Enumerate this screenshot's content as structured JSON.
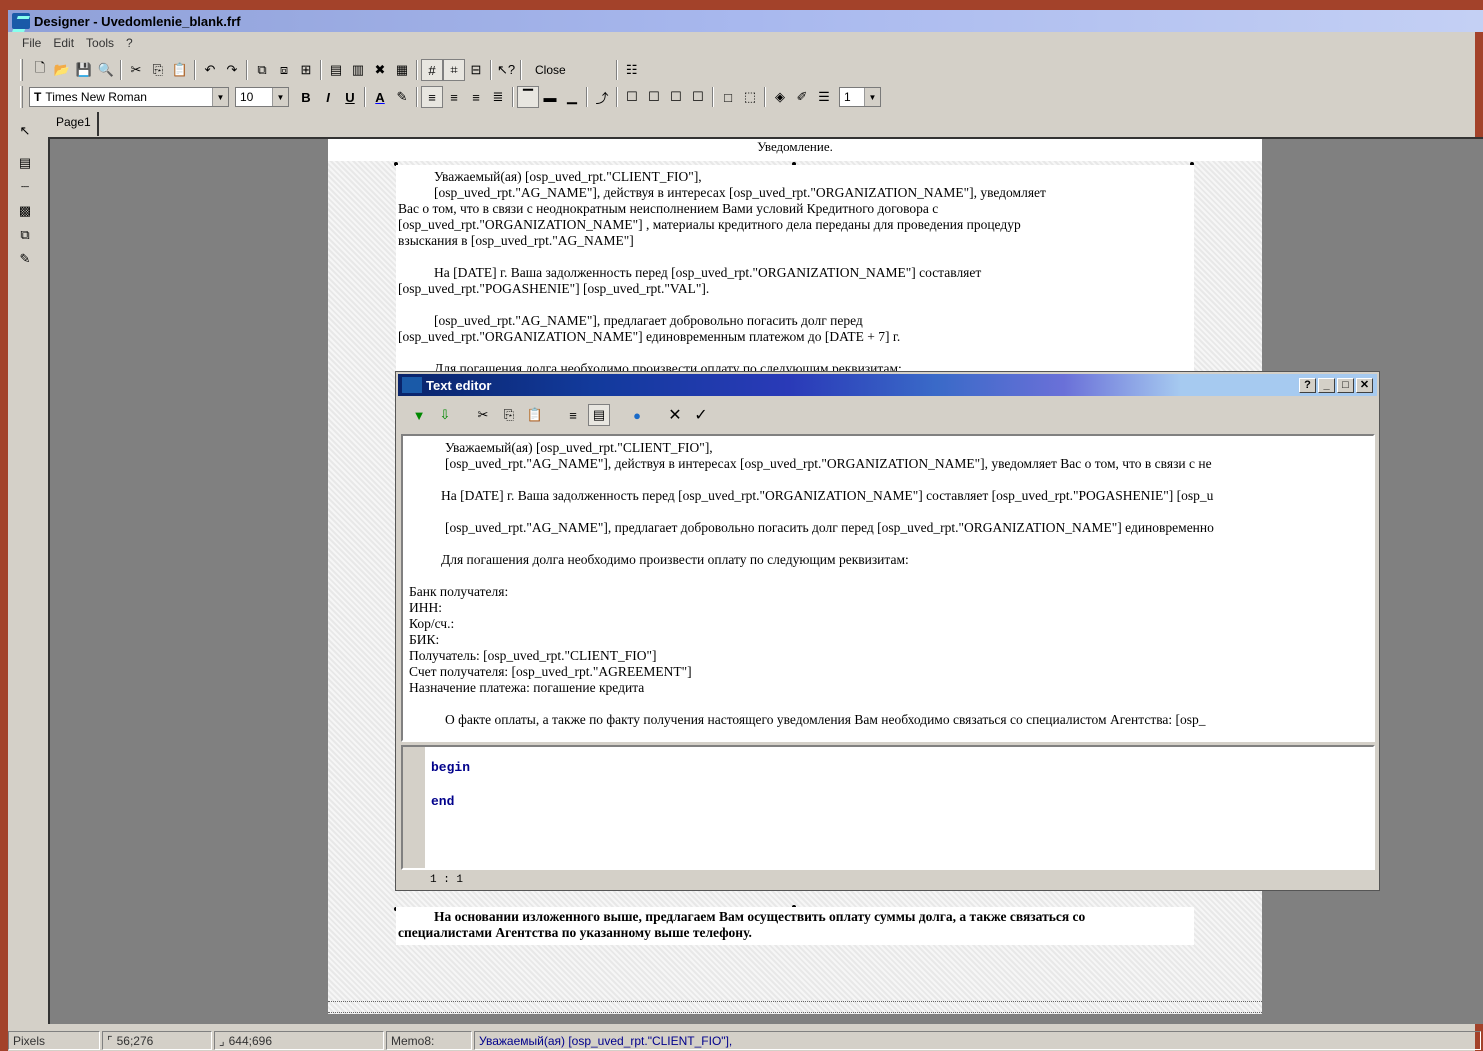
{
  "window": {
    "title": "Designer - Uvedomlenie_blank.frf"
  },
  "menu": [
    "File",
    "Edit",
    "Tools",
    "?"
  ],
  "toolbar": {
    "close_label": "Close"
  },
  "format": {
    "font_name": "Times New Roman",
    "font_size": "10",
    "frame_width": "1"
  },
  "tabs": [
    {
      "label": "Page1"
    }
  ],
  "page": {
    "header": "Уведомление.",
    "memo_lines": [
      "Уважаемый(ая) [osp_uved_rpt.\"CLIENT_FIO\"],",
      "[osp_uved_rpt.\"AG_NAME\"], действуя в интересах [osp_uved_rpt.\"ORGANIZATION_NAME\"], уведомляет",
      "Вас о том, что в связи с неоднократным неисполнением Вами условий Кредитного договора с",
      "[osp_uved_rpt.\"ORGANIZATION_NAME\"] , материалы кредитного дела переданы для проведения процедур",
      "взыскания в [osp_uved_rpt.\"AG_NAME\"]",
      "На [DATE] г. Ваша задолженность перед [osp_uved_rpt.\"ORGANIZATION_NAME\"] составляет",
      "[osp_uved_rpt.\"POGASHENIE\"] [osp_uved_rpt.\"VAL\"].",
      "[osp_uved_rpt.\"AG_NAME\"], предлагает добровольно погасить долг перед",
      "[osp_uved_rpt.\"ORGANIZATION_NAME\"] единовременным платежом до [DATE + 7] г.",
      "Для погашения долга необходимо произвести оплату по следующим реквизитам:"
    ],
    "bottom_memo_lines": [
      "На основании изложенного выше, предлагаем Вам осуществить оплату суммы долга, а также связаться со",
      "специалистами Агентства по указанному выше телефону."
    ]
  },
  "text_editor": {
    "title": "Text editor",
    "lines": [
      "Уважаемый(ая) [osp_uved_rpt.\"CLIENT_FIO\"],",
      "[osp_uved_rpt.\"AG_NAME\"], действуя в интересах [osp_uved_rpt.\"ORGANIZATION_NAME\"], уведомляет Вас о том, что в связи с не",
      "На [DATE] г. Ваша задолженность перед [osp_uved_rpt.\"ORGANIZATION_NAME\"] составляет [osp_uved_rpt.\"POGASHENIE\"] [osp_u",
      "[osp_uved_rpt.\"AG_NAME\"], предлагает добровольно погасить долг перед [osp_uved_rpt.\"ORGANIZATION_NAME\"] единовременно",
      "Для погашения долга необходимо произвести оплату по следующим реквизитам:",
      "Банк получателя:",
      "ИНН:",
      "Кор/сч.:",
      "БИК:",
      "Получатель: [osp_uved_rpt.\"CLIENT_FIO\"]",
      "Счет получателя: [osp_uved_rpt.\"AGREEMENT\"]",
      "Назначение платежа: погашение кредита",
      "О факте оплаты, а также по факту получения настоящего уведомления Вам необходимо связаться со  специалистом Агентства:  [osp_"
    ],
    "script_begin": "begin",
    "script_end": "end",
    "cursor_pos": "1 : 1"
  },
  "status": {
    "units": "Pixels",
    "position": "56;276",
    "size": "644;696",
    "object": "Memo8:",
    "object_text": "Уважаемый(ая) [osp_uved_rpt.\"CLIENT_FIO\"],"
  }
}
